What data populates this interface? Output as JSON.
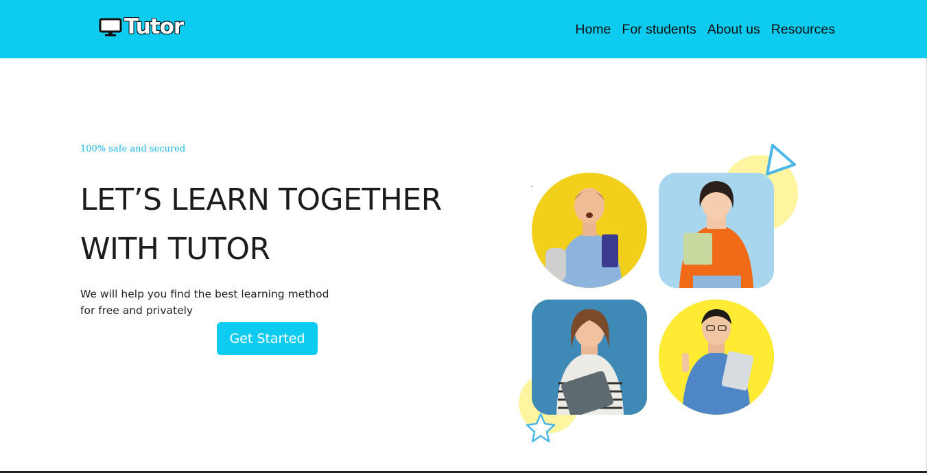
{
  "header": {
    "logo_text": "Tutor",
    "logo_icon": "monitor-icon",
    "nav": [
      {
        "label": "Home"
      },
      {
        "label": "For students"
      },
      {
        "label": "About us"
      },
      {
        "label": "Resources"
      }
    ]
  },
  "hero": {
    "tagline": "100% safe and secured",
    "headline_line1": "LET’S LEARN TOGETHER",
    "headline_line2": "WITH TUTOR",
    "subtext_line1": "We will help you find the best learning method",
    "subtext_line2": "for free and privately",
    "cta_label": "Get Started"
  },
  "colors": {
    "brand": "#0ecbf0",
    "accent_yellow": "#ffe92e",
    "pale_yellow": "#fff5a0",
    "text_dark": "#1c1c1c"
  }
}
